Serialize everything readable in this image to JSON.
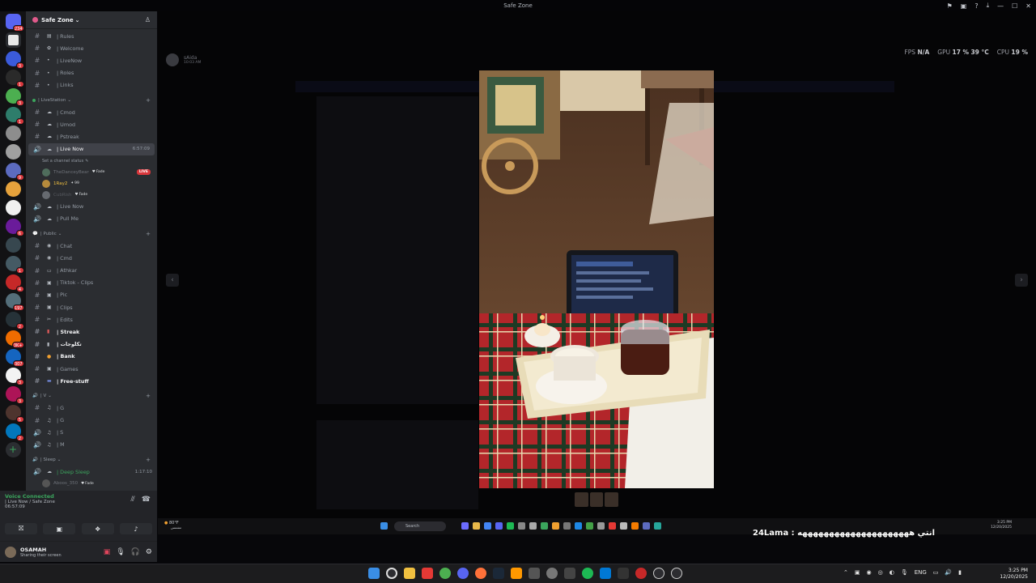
{
  "window": {
    "title": "Safe Zone"
  },
  "server": {
    "name": "Safe Zone"
  },
  "rail_badges": [
    "234",
    "3",
    "1",
    "3",
    "1",
    "9",
    "6",
    "1",
    "4",
    "197",
    "2",
    "3K+",
    "307",
    "3",
    "3",
    "5",
    "2"
  ],
  "channels_top": [
    {
      "name": "| Rules",
      "icon": "hash"
    },
    {
      "name": "| Welcome",
      "icon": "hash"
    },
    {
      "name": "| LiveNow",
      "icon": "hash"
    },
    {
      "name": "| Roles",
      "icon": "hash"
    },
    {
      "name": "| Links",
      "icon": "hash"
    }
  ],
  "livestation": {
    "category": "| LiveStation",
    "channels": [
      "| Cmod",
      "| Umod",
      "| Pstreak"
    ],
    "active": {
      "name": "| Live Now",
      "time": "6:57:09",
      "status": "Set a channel status"
    },
    "voice_users": [
      {
        "name": "TheDanceyBear",
        "tag": "Fade",
        "live": "LIVE"
      },
      {
        "name": "1Ray2",
        "tag": "99"
      },
      {
        "name": "CubRish",
        "tag": "Fade"
      }
    ],
    "extra": [
      "| Live Now",
      "| Pull Me"
    ]
  },
  "public": {
    "category": "| Public",
    "channels": [
      "| Chat",
      "| Cmd",
      "| Athkar",
      "| Tiktok - Clips",
      "| Pic",
      "| Clips",
      "| Edits",
      "| Streak",
      "| تكلوجات",
      "| Bank",
      "| Games",
      "| Free-stuff"
    ]
  },
  "v_cat": {
    "category": "| V",
    "channels": [
      "| G",
      "| G",
      "| S",
      "| M"
    ]
  },
  "sleep": {
    "category": "| Sleep",
    "channel": "| Deep Sleep",
    "time": "1:17:10",
    "user": {
      "name": "Aboos_350",
      "tag": "Fade"
    }
  },
  "voice": {
    "title": "Voice Connected",
    "channel": "| Live Now / Safe Zone",
    "duration": "06:57:09"
  },
  "user": {
    "name": "OSAMAH",
    "status": "Sharing their screen"
  },
  "stream": {
    "streamer": "sAida",
    "streamer_time": "10:03 AM",
    "fps_label": "FPS",
    "fps_value": "N/A",
    "gpu_label": "GPU",
    "gpu_value": "17 %",
    "gpu_temp": "39 °C",
    "cpu_label": "CPU",
    "cpu_value": "19 %"
  },
  "inner_taskbar": {
    "weather": "80°F",
    "weather_sub": "مشمس",
    "search": "Search",
    "time": "3:25 PM",
    "date": "12/20/2025"
  },
  "chat_overlay": "24Lama : انتي هههههههههههههههههههههه",
  "taskbar": {
    "lang": "ENG",
    "time": "3:25 PM",
    "date": "12/20/2025"
  },
  "colors": {
    "accent": "#5865f2",
    "online": "#3ba55d",
    "live": "#da373c",
    "sidebar": "#2b2d31",
    "rail": "#121214"
  }
}
